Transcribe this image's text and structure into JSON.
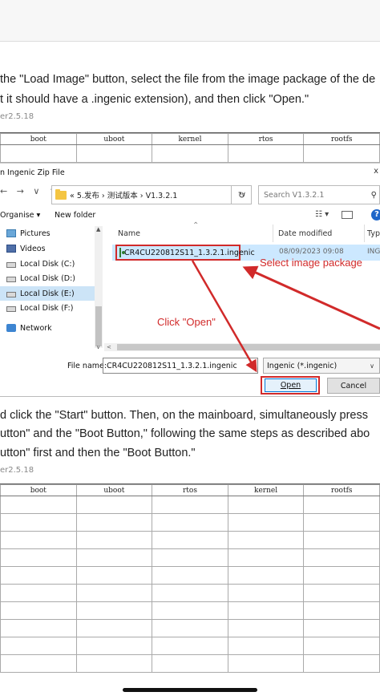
{
  "doc": {
    "para1_line1": "the \"Load Image\" button, select the file from the image package of the de",
    "para1_line2": "t it should have a .ingenic extension), and then click \"Open.\"",
    "tool_label_1": "er2.5.18",
    "table1_headers": [
      "boot",
      "uboot",
      "kernel",
      "rtos",
      "rootfs"
    ],
    "para2_line1": "d click the \"Start\" button. Then, on the mainboard, simultaneously press",
    "para2_line2": "utton\" and the \"Boot Button,\" following the same steps as described abo",
    "para2_line3": "utton\" first and then the \"Boot Button.\"",
    "tool_label_2": "er2.5.18",
    "table2_headers": [
      "boot",
      "uboot",
      "rtos",
      "kernel",
      "rootfs"
    ]
  },
  "dialog": {
    "title": "n Ingenic Zip File",
    "close_glyph": "x",
    "nav_glyphs": "← → ∨ ↑",
    "address": "«  5.发布  ›  测试版本  ›  V1.3.2.1",
    "search_placeholder": "Search V1.3.2.1",
    "organise": "Organise ▾",
    "new_folder": "New folder",
    "nav_items": [
      {
        "label": "Pictures",
        "icon": "pictures-icon"
      },
      {
        "label": "Videos",
        "icon": "videos-icon"
      },
      {
        "label": "Local Disk (C:)",
        "icon": "disk-icon"
      },
      {
        "label": "Local Disk (D:)",
        "icon": "disk-icon"
      },
      {
        "label": "Local Disk (E:)",
        "icon": "disk-icon"
      },
      {
        "label": "Local Disk (F:)",
        "icon": "disk-icon"
      },
      {
        "label": "Network",
        "icon": "network-icon"
      }
    ],
    "columns": {
      "name": "Name",
      "date": "Date modified",
      "type": "Typ"
    },
    "file": {
      "name": "CR4CU220812S11_1.3.2.1.ingenic",
      "date": "08/09/2023 09:08",
      "type": "ING"
    },
    "file_name_label": "File name:",
    "file_name_value": "CR4CU220812S11_1.3.2.1.ingenic",
    "file_type_value": "Ingenic (*.ingenic)",
    "open_label": "Open",
    "cancel_label": "Cancel"
  },
  "annotations": {
    "select_image_package": "Select image package",
    "click_open": "Click \"Open\"",
    "color": "#d12a2a"
  }
}
